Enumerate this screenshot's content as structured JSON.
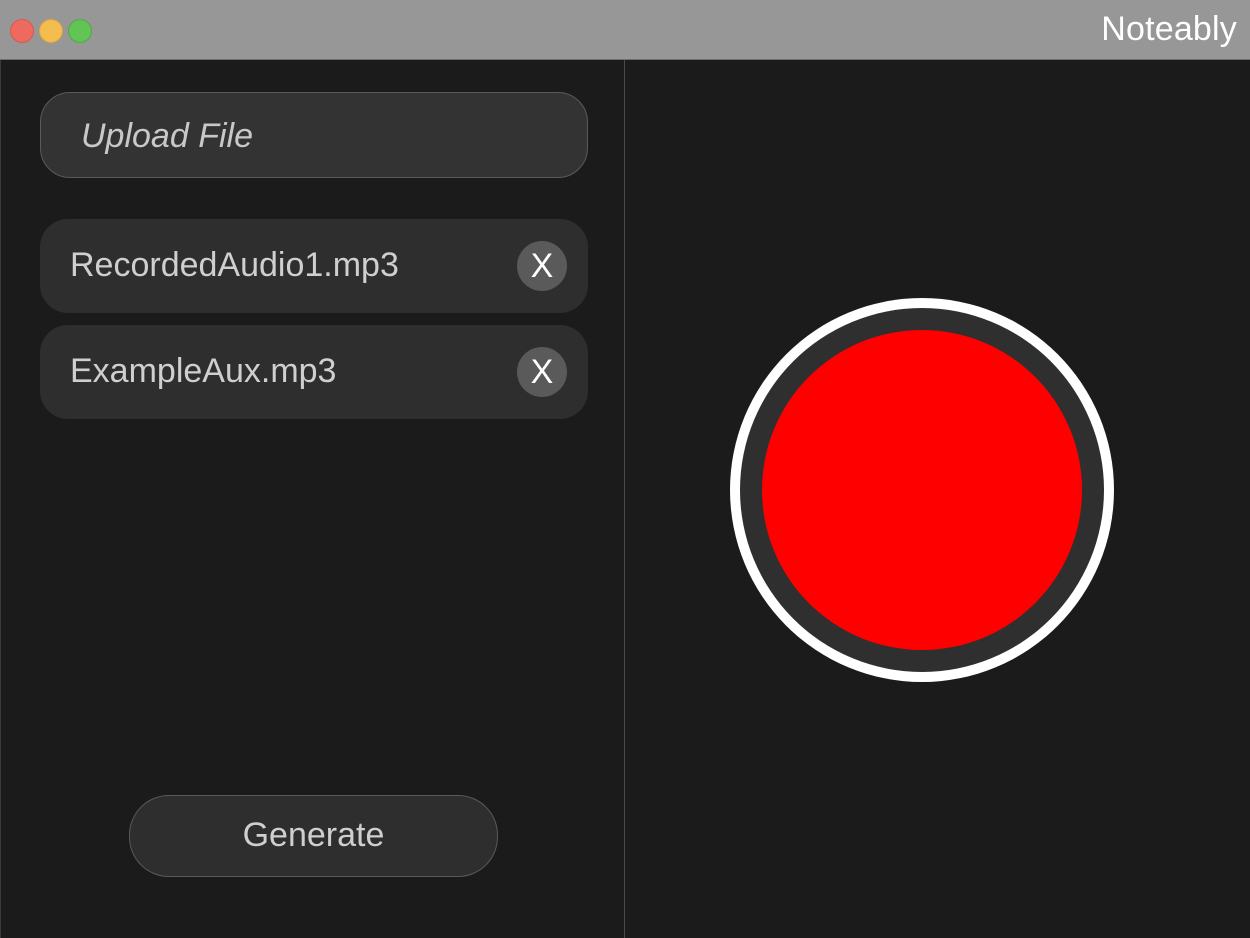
{
  "window": {
    "title": "Noteably"
  },
  "left_panel": {
    "upload": {
      "label": "Upload File"
    },
    "files": [
      {
        "name": "RecordedAudio1.mp3",
        "remove_label": "X"
      },
      {
        "name": "ExampleAux.mp3",
        "remove_label": "X"
      }
    ],
    "generate": {
      "label": "Generate"
    }
  },
  "right_panel": {
    "record_button": {
      "icon": "record-icon",
      "color": "#ff0000"
    }
  },
  "colors": {
    "background": "#1b1b1b",
    "titlebar": "#979797",
    "control": "#333333",
    "record": "#ff0000"
  }
}
